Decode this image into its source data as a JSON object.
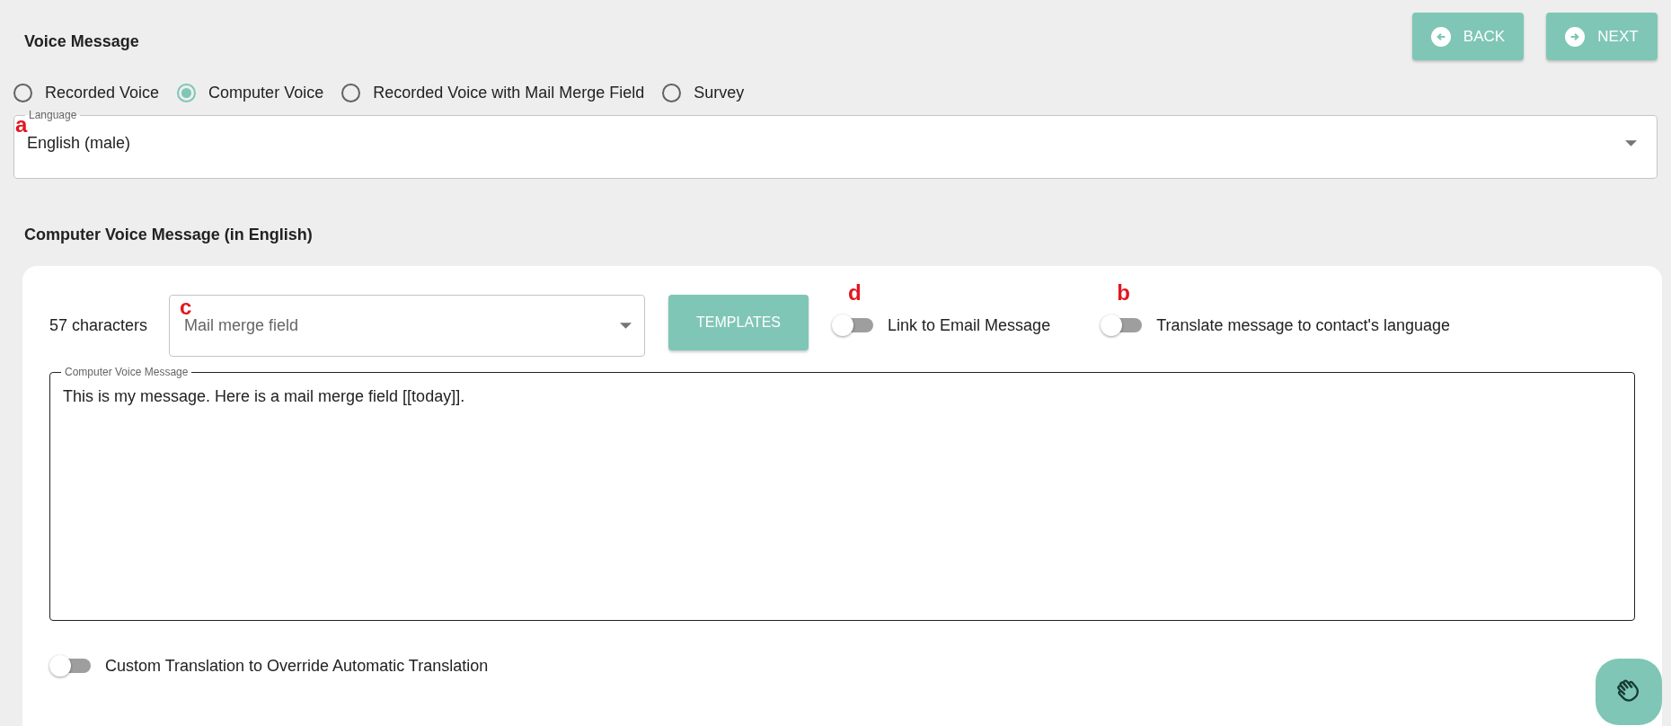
{
  "header": {
    "title": "Voice Message",
    "buttons": [
      {
        "kind": "back",
        "label": "BACK"
      },
      {
        "kind": "next",
        "label": "NEXT"
      }
    ]
  },
  "voice_types": [
    {
      "label": "Recorded Voice",
      "selected": false
    },
    {
      "label": "Computer Voice",
      "selected": true
    },
    {
      "label": "Recorded Voice with Mail Merge Field",
      "selected": false
    },
    {
      "label": "Survey",
      "selected": false
    }
  ],
  "language": {
    "label": "Language",
    "value": "English (male)",
    "marker": "a"
  },
  "message_section": {
    "heading": "Computer Voice Message (in English)",
    "character_count": "57 characters",
    "merge_field": {
      "placeholder": "Mail merge field",
      "marker": "c"
    },
    "templates_button": "TEMPLATES",
    "toggles": [
      {
        "label": "Link to Email Message",
        "on": false,
        "marker": "d"
      },
      {
        "label": "Translate message to contact's language",
        "on": false,
        "marker": "b"
      }
    ],
    "message": {
      "label": "Computer Voice Message",
      "value": "This is my message. Here is a mail merge field [[today]]."
    },
    "custom_translation": {
      "label": "Custom Translation to Override Automatic Translation",
      "on": false
    }
  }
}
